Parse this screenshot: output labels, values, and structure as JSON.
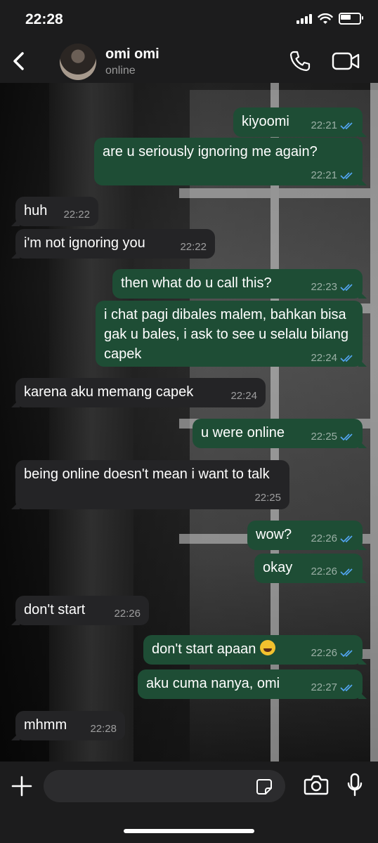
{
  "status_bar": {
    "time": "22:28"
  },
  "header": {
    "contact_name": "omi omi",
    "contact_status": "online"
  },
  "messages": [
    {
      "dir": "out",
      "text": "kiyoomi",
      "time": "22:21"
    },
    {
      "dir": "out",
      "text": "are u seriously ignoring me again?",
      "time": "22:21"
    },
    {
      "dir": "in",
      "text": "huh",
      "time": "22:22"
    },
    {
      "dir": "in",
      "text": "i'm not ignoring you",
      "time": "22:22"
    },
    {
      "dir": "out",
      "text": "then what do u call this?",
      "time": "22:23"
    },
    {
      "dir": "out",
      "text": "i chat pagi dibales malem, bahkan bisa gak u bales, i ask to see u selalu bilang capek",
      "time": "22:24"
    },
    {
      "dir": "in",
      "text": "karena aku memang capek",
      "time": "22:24"
    },
    {
      "dir": "out",
      "text": "u were online",
      "time": "22:25"
    },
    {
      "dir": "in",
      "text": "being online doesn't mean i want to talk",
      "time": "22:25"
    },
    {
      "dir": "out",
      "text": "wow?",
      "time": "22:26"
    },
    {
      "dir": "out",
      "text": "okay",
      "time": "22:26"
    },
    {
      "dir": "in",
      "text": "don't start",
      "time": "22:26"
    },
    {
      "dir": "out",
      "text": "don't start apaan",
      "emoji": "loudly-crying-face",
      "time": "22:26"
    },
    {
      "dir": "out",
      "text": "aku cuma nanya, omi",
      "time": "22:27"
    },
    {
      "dir": "in",
      "text": "mhmm",
      "time": "22:28"
    }
  ],
  "input": {
    "placeholder": ""
  },
  "colors": {
    "outgoing_bubble": "#1e4d35",
    "incoming_bubble": "#242426",
    "read_ticks": "#53a6f5"
  }
}
